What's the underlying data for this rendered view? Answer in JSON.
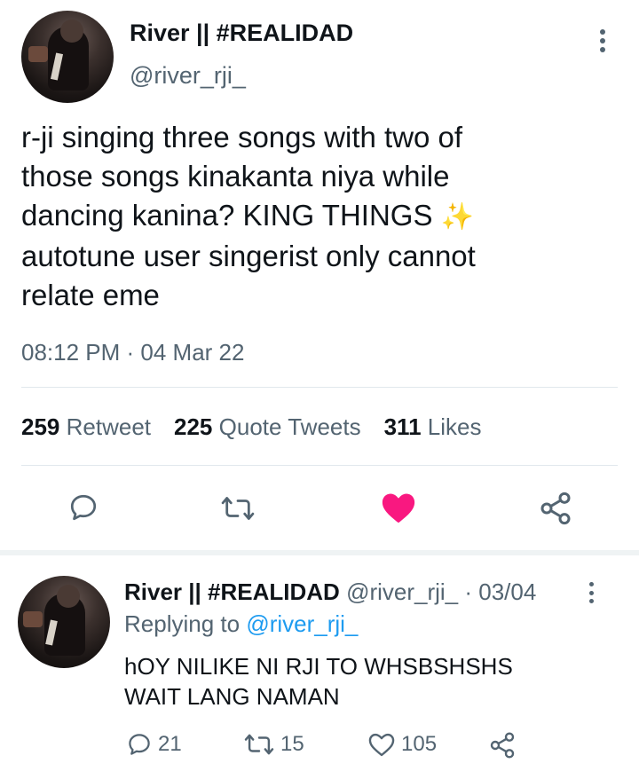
{
  "tweet": {
    "author_name": "River || #REALIDAD",
    "author_handle": "@river_rji_",
    "text": "r-ji singing three songs with two of\nthose songs kinakanta niya while\ndancing kanina? KING THINGS ",
    "text_emoji": "✨",
    "text_tail": "\nautotune user singerist only cannot\nrelate eme",
    "timestamp": "08:12 PM · 04 Mar 22",
    "stats": {
      "retweets_count": "259",
      "retweets_label": "Retweet",
      "quotes_count": "225",
      "quotes_label": "Quote Tweets",
      "likes_count": "311",
      "likes_label": "Likes"
    },
    "actions": {
      "reply_icon": "reply-icon",
      "retweet_icon": "retweet-icon",
      "like_icon": "heart-filled-icon",
      "share_icon": "share-icon",
      "like_color": "#f91880"
    }
  },
  "reply": {
    "author_name": "River || #REALIDAD",
    "meta": "@river_rji_ · 03/04",
    "replying_prefix": "Replying to ",
    "replying_handle": "@river_rji_",
    "text": "hOY NILIKE NI RJI TO WHSBSHSHS\nWAIT LANG NAMAN",
    "reply_count": "21",
    "retweet_count": "15",
    "like_count": "105"
  },
  "colors": {
    "text": "#0f1419",
    "secondary": "#536471",
    "accent": "#1d9bf0",
    "like": "#f91880"
  }
}
